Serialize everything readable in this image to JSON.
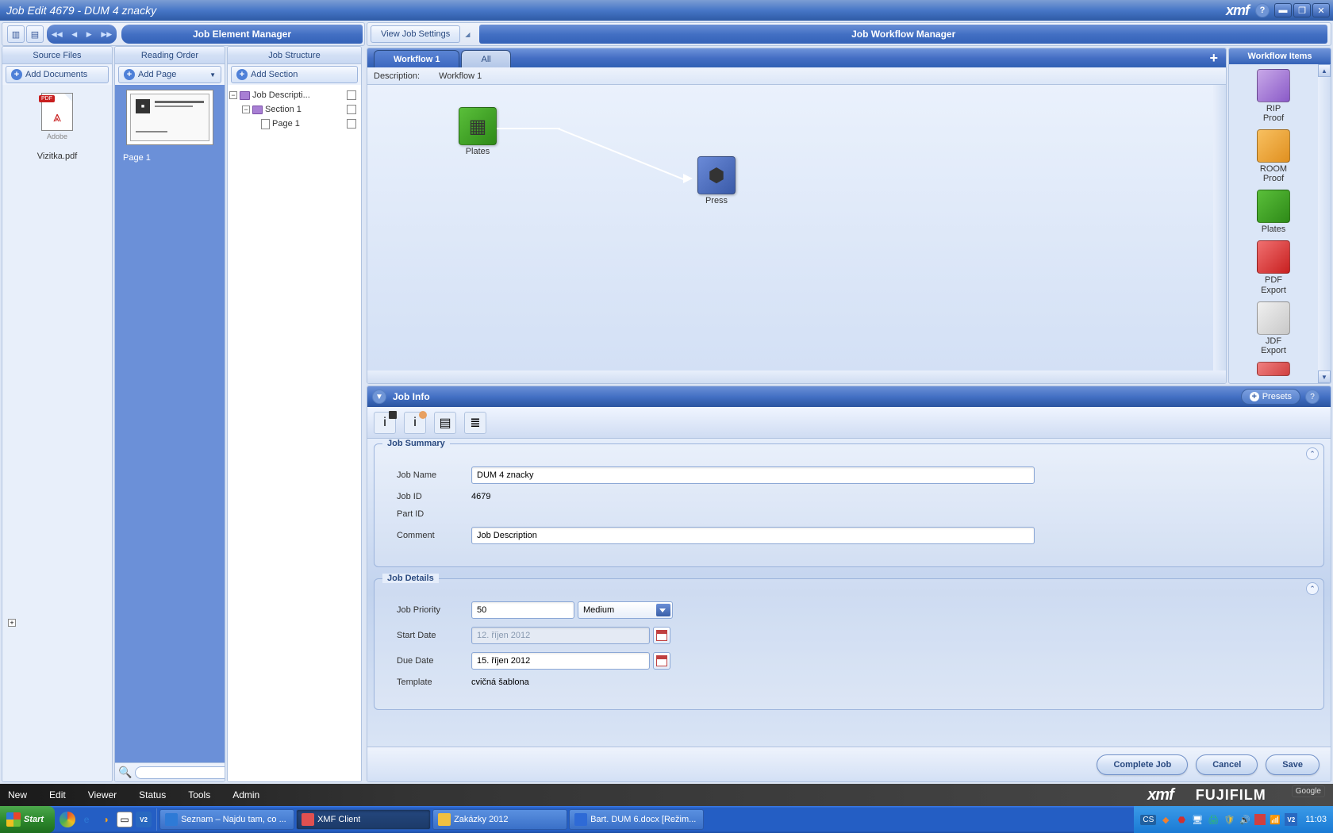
{
  "titlebar": {
    "title": "Job Edit 4679 - DUM 4 znacky",
    "logo": "xmf"
  },
  "left": {
    "manager_title": "Job Element Manager",
    "source_files": {
      "header": "Source Files",
      "action": "Add Documents",
      "file_name": "Vizitka.pdf",
      "pdf_badge": "PDF"
    },
    "reading_order": {
      "header": "Reading Order",
      "action": "Add Page",
      "page_label": "Page 1"
    },
    "job_structure": {
      "header": "Job Structure",
      "action": "Add Section",
      "tree": {
        "root": "Job Descripti...",
        "section": "Section 1",
        "page": "Page 1"
      }
    }
  },
  "right": {
    "view_button": "View Job Settings",
    "manager_title": "Job Workflow Manager",
    "tabs": {
      "active": "Workflow 1",
      "inactive": "All"
    },
    "desc_label": "Description:",
    "desc_value": "Workflow 1",
    "nodes": {
      "plates": "Plates",
      "press": "Press"
    },
    "items_panel": {
      "title": "Workflow Items",
      "items": [
        {
          "label": "RIP\nProof",
          "color": "linear-gradient(135deg,#c8a8e8,#8a5ac8)"
        },
        {
          "label": "ROOM\nProof",
          "color": "linear-gradient(135deg,#f8c060,#e09020)"
        },
        {
          "label": "Plates",
          "color": "linear-gradient(135deg,#5abf3a,#2e8a18)"
        },
        {
          "label": "PDF\nExport",
          "color": "linear-gradient(135deg,#f07070,#c82020)"
        },
        {
          "label": "JDF\nExport",
          "color": "linear-gradient(135deg,#f0f0f0,#c8c8c8)"
        }
      ]
    }
  },
  "job_info": {
    "title": "Job Info",
    "presets": "Presets",
    "summary": {
      "legend": "Job Summary",
      "name_label": "Job Name",
      "name_value": "DUM 4 znacky",
      "id_label": "Job ID",
      "id_value": "4679",
      "part_label": "Part ID",
      "part_value": "",
      "comment_label": "Comment",
      "comment_value": "Job Description"
    },
    "details": {
      "legend": "Job Details",
      "priority_label": "Job Priority",
      "priority_value": "50",
      "priority_level": "Medium",
      "start_label": "Start Date",
      "start_value": "12. říjen 2012",
      "due_label": "Due Date",
      "due_value": "15. říjen 2012",
      "template_label": "Template",
      "template_value": "cvičná šablona"
    },
    "buttons": {
      "complete": "Complete Job",
      "cancel": "Cancel",
      "save": "Save"
    }
  },
  "menubar": {
    "items": [
      "New",
      "Edit",
      "Viewer",
      "Status",
      "Tools",
      "Admin"
    ],
    "brand_xmf": "xmf",
    "brand_fuji": "FUJIFILM",
    "google": "Google"
  },
  "taskbar": {
    "start": "Start",
    "items": [
      {
        "label": "Seznam – Najdu tam, co ...",
        "icon_color": "#2e7ad6",
        "active": false
      },
      {
        "label": "XMF Client",
        "icon_color": "#e05050",
        "active": true
      },
      {
        "label": "Zakázky 2012",
        "icon_color": "#f0c040",
        "active": false
      },
      {
        "label": "Bart. DUM 6.docx [Režim...",
        "icon_color": "#2e6ad6",
        "active": false
      }
    ],
    "tray_lang": "CS",
    "tray_time": "11:03"
  }
}
